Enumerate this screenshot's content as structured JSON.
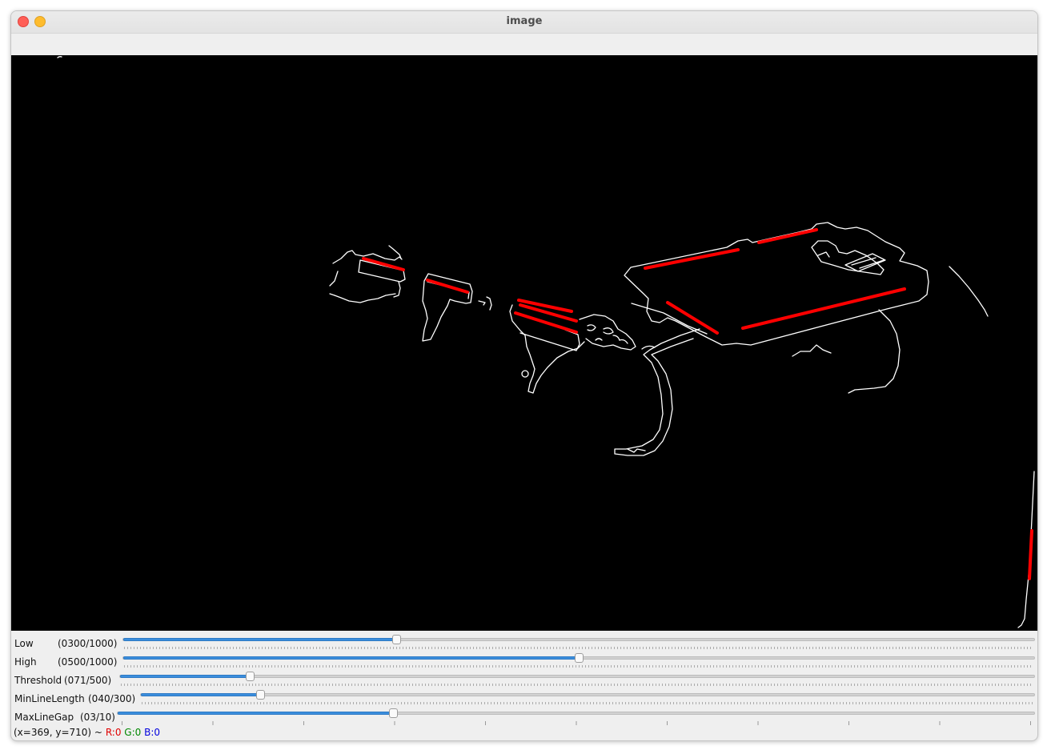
{
  "window": {
    "title": "image",
    "buttons": [
      "close",
      "minimize"
    ]
  },
  "canvas": {
    "background": "#000000",
    "edge_color": "#ffffff",
    "line_color": "#ff0000"
  },
  "trackbars": [
    {
      "name": "Low",
      "value_text": "(0300/1000)",
      "value": 300,
      "max": 1000
    },
    {
      "name": "High",
      "value_text": "(0500/1000)",
      "value": 500,
      "max": 1000
    },
    {
      "name": "Threshold",
      "value_text": "(071/500)",
      "value": 71,
      "max": 500
    },
    {
      "name": "MinLineLength",
      "value_text": "(040/300)",
      "value": 40,
      "max": 300
    },
    {
      "name": "MaxLineGap",
      "value_text": "(03/10)",
      "value": 3,
      "max": 10
    }
  ],
  "status": {
    "coords": "(x=369, y=710) ~",
    "r": "R:0",
    "g": "G:0",
    "b": "B:0"
  },
  "colors": {
    "accent": "#3b8edd",
    "close_button": "#ff5f57",
    "minimize_button": "#febc2e"
  }
}
